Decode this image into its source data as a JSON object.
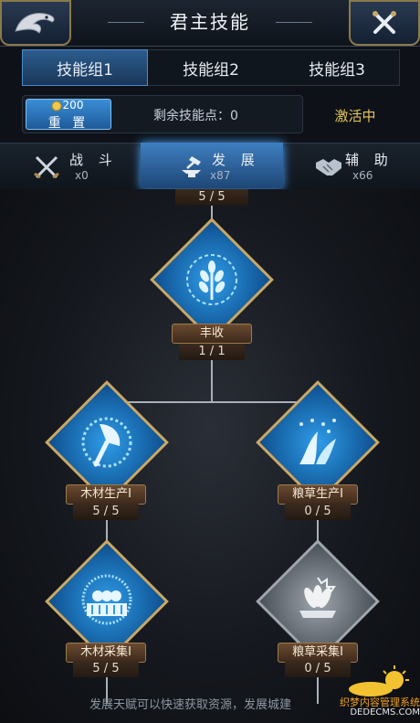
{
  "header": {
    "title": "君主技能"
  },
  "groups": [
    {
      "label": "技能组1"
    },
    {
      "label": "技能组2"
    },
    {
      "label": "技能组3"
    }
  ],
  "reset": {
    "cost": "200",
    "label": "重 置"
  },
  "points": {
    "text": "剩余技能点：0"
  },
  "activate_label": "激活中",
  "categories": [
    {
      "name": "战 斗",
      "count": "x0"
    },
    {
      "name": "发 展",
      "count": "x87"
    },
    {
      "name": "辅 助",
      "count": "x66"
    }
  ],
  "tree": {
    "top_level": "5 / 5",
    "nodes": [
      {
        "name": "丰收",
        "level": "1 / 1"
      },
      {
        "name": "木材生产Ⅰ",
        "level": "5 / 5"
      },
      {
        "name": "粮草生产Ⅰ",
        "level": "0 / 5"
      },
      {
        "name": "木材采集Ⅰ",
        "level": "5 / 5"
      },
      {
        "name": "粮草采集Ⅰ",
        "level": "0 / 5"
      }
    ]
  },
  "hint": "发展天赋可以快速获取资源，发展城建",
  "watermark": {
    "line1": "织梦内容管理系统",
    "line2": "DEDECMS.COM"
  },
  "colors": {
    "accent_blue": "#2f9ce8",
    "gold": "#c9a867",
    "active_text": "#e7c65a"
  }
}
